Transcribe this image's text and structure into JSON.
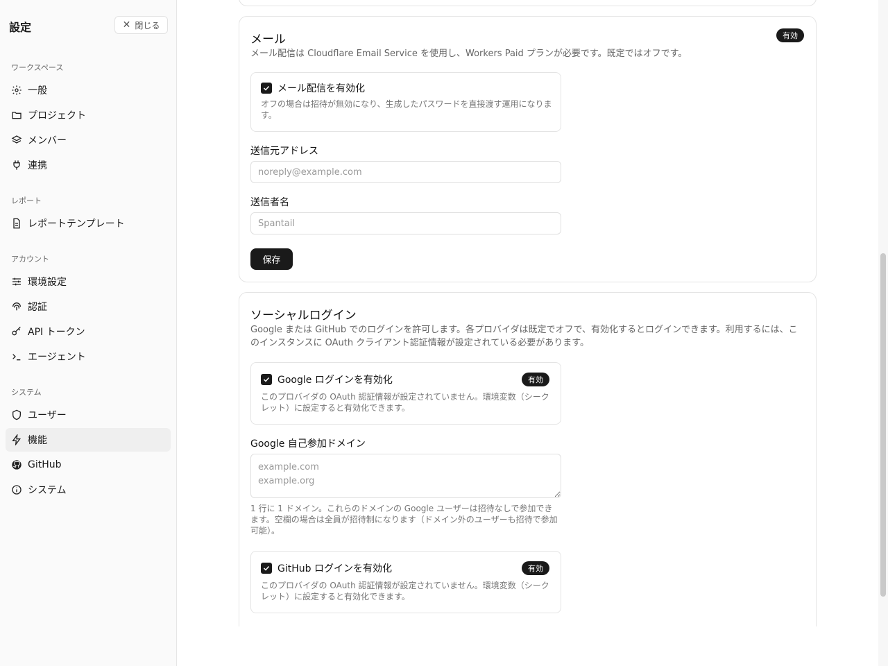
{
  "sidebar": {
    "title": "設定",
    "close_label": "閉じる",
    "groups": [
      {
        "label": "ワークスペース",
        "items": [
          {
            "label": "一般",
            "icon": "gear-icon"
          },
          {
            "label": "プロジェクト",
            "icon": "folder-icon"
          },
          {
            "label": "メンバー",
            "icon": "layers-icon"
          },
          {
            "label": "連携",
            "icon": "plug-icon"
          }
        ]
      },
      {
        "label": "レポート",
        "items": [
          {
            "label": "レポートテンプレート",
            "icon": "document-icon"
          }
        ]
      },
      {
        "label": "アカウント",
        "items": [
          {
            "label": "環境設定",
            "icon": "sliders-icon"
          },
          {
            "label": "認証",
            "icon": "fingerprint-icon"
          },
          {
            "label": "API トークン",
            "icon": "key-icon"
          },
          {
            "label": "エージェント",
            "icon": "terminal-icon"
          }
        ]
      },
      {
        "label": "システム",
        "items": [
          {
            "label": "ユーザー",
            "icon": "shield-icon"
          },
          {
            "label": "機能",
            "icon": "lightning-icon",
            "active": true
          },
          {
            "label": "GitHub",
            "icon": "github-icon"
          },
          {
            "label": "システム",
            "icon": "info-icon"
          }
        ]
      }
    ]
  },
  "mail": {
    "title": "メール",
    "badge": "有効",
    "description": "メール配信は Cloudflare Email Service を使用し、Workers Paid プランが必要です。既定ではオフです。",
    "enable_label": "メール配信を有効化",
    "enable_checked": true,
    "enable_desc": "オフの場合は招待が無効になり、生成したパスワードを直接渡す運用になります。",
    "from_address_label": "送信元アドレス",
    "from_address_placeholder": "noreply@example.com",
    "sender_name_label": "送信者名",
    "sender_name_placeholder": "Spantail",
    "save_label": "保存"
  },
  "social": {
    "title": "ソーシャルログイン",
    "description": "Google または GitHub でのログインを許可します。各プロバイダは既定でオフで、有効化するとログインできます。利用するには、このインスタンスに OAuth クライアント認証情報が設定されている必要があります。",
    "google": {
      "label": "Google ログインを有効化",
      "badge": "有効",
      "checked": true,
      "desc": "このプロバイダの OAuth 認証情報が設定されていません。環境変数（シークレット）に設定すると有効化できます。"
    },
    "domain_label": "Google 自己参加ドメイン",
    "domain_placeholder": "example.com\nexample.org",
    "domain_hint": "1 行に 1 ドメイン。これらのドメインの Google ユーザーは招待なしで参加できます。空欄の場合は全員が招待制になります（ドメイン外のユーザーも招待で参加可能）。",
    "github": {
      "label": "GitHub ログインを有効化",
      "badge": "有効",
      "checked": true,
      "desc": "このプロバイダの OAuth 認証情報が設定されていません。環境変数（シークレット）に設定すると有効化できます。"
    }
  }
}
